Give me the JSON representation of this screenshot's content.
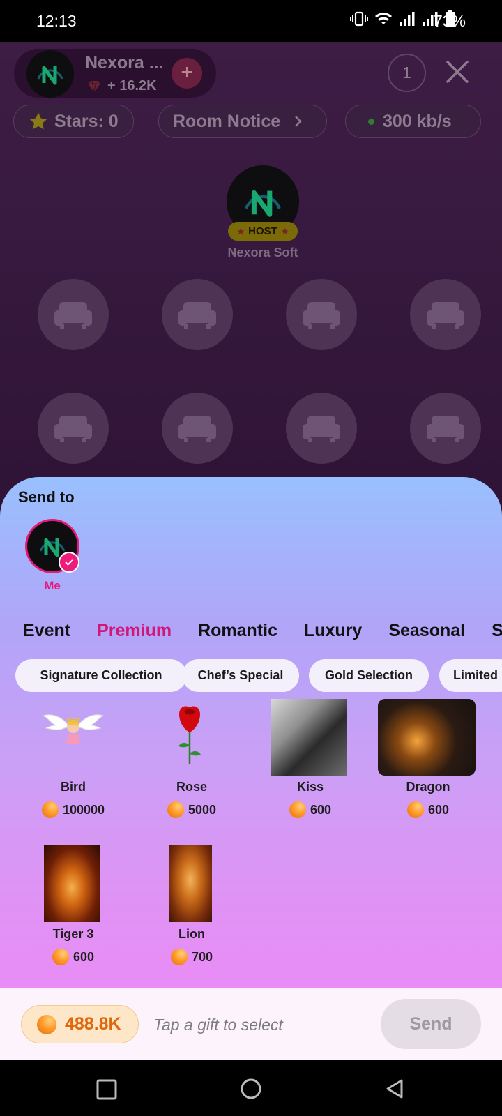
{
  "status_bar": {
    "time": "12:13",
    "battery": "73%"
  },
  "room": {
    "host_name": "Nexora ...",
    "host_stat": "+ 16.2K",
    "viewer_count": "1",
    "stars_label": "Stars: 0",
    "notice_label": "Room Notice",
    "speed_label": "300 kb/s",
    "host_badge": "HOST",
    "host_seat_name": "Nexora Soft"
  },
  "panel": {
    "send_to_label": "Send to",
    "recipient_label": "Me",
    "tabs": [
      {
        "label": "Event",
        "active": false
      },
      {
        "label": "Premium",
        "active": true
      },
      {
        "label": "Romantic",
        "active": false
      },
      {
        "label": "Luxury",
        "active": false
      },
      {
        "label": "Seasonal",
        "active": false
      },
      {
        "label": "S",
        "active": false
      }
    ],
    "subcategories": [
      "Signature Collection",
      "Chef’s Special",
      "Gold Selection",
      "Limited"
    ],
    "gifts": [
      {
        "name": "Bird",
        "price": "100000"
      },
      {
        "name": "Rose",
        "price": "5000"
      },
      {
        "name": "Kiss",
        "price": "600"
      },
      {
        "name": "Dragon",
        "price": "600"
      },
      {
        "name": "Tiger 3",
        "price": "600"
      },
      {
        "name": "Lion",
        "price": "700"
      }
    ]
  },
  "footer": {
    "balance": "488.8K",
    "hint": "Tap a gift to select",
    "send_label": "Send"
  },
  "colors": {
    "accent": "#d01777",
    "coin": "#ff9a2a",
    "panel_top": "#98c0fe",
    "panel_bottom": "#e98cf6"
  }
}
